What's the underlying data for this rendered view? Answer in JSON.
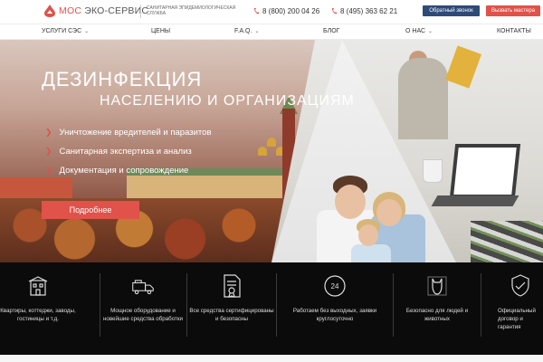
{
  "header": {
    "logo_part1": "МОС",
    "logo_part2": "ЭКО-СЕРВИС",
    "tagline": "Санитарная эпидемиологическая служба",
    "phone1": "8 (800) 200 04 26",
    "phone2": "8 (495) 363 62 21",
    "callback_label": "Обратный звонок",
    "master_label": "Вызвать мастера"
  },
  "nav": {
    "items": [
      {
        "label": "УСЛУГИ СЭС",
        "dropdown": true
      },
      {
        "label": "ЦЕНЫ",
        "dropdown": false
      },
      {
        "label": "F.A.Q.",
        "dropdown": true
      },
      {
        "label": "БЛОГ",
        "dropdown": false
      },
      {
        "label": "О НАС",
        "dropdown": true
      },
      {
        "label": "КОНТАКТЫ",
        "dropdown": false
      }
    ]
  },
  "hero": {
    "title": "ДЕЗИНФЕКЦИЯ",
    "subtitle": "НАСЕЛЕНИЮ И ОРГАНИЗАЦИЯМ",
    "bullets": [
      "Уничтожение вредителей и паразитов",
      "Санитарная экспертиза и анализ",
      "Документация и сопровождение"
    ],
    "button_label": "Подробнее"
  },
  "features": [
    {
      "icon": "building-icon",
      "text": "Квартиры, коттеджи, заводы, гостиницы и т.д."
    },
    {
      "icon": "truck-icon",
      "text": "Мощное оборудование и новейшие средства обработки"
    },
    {
      "icon": "certificate-icon",
      "text": "Все средства сертифицированы и безопасны"
    },
    {
      "icon": "clock-24-icon",
      "text": "Работаем без выходных, заявки круглосуточно"
    },
    {
      "icon": "cat-icon",
      "text": "Безопасно для людей и животных"
    },
    {
      "icon": "shield-check-icon",
      "text": "Официальный договор и гарантия"
    }
  ],
  "colors": {
    "accent": "#e0524a",
    "navy": "#2e4a78",
    "strip": "#0b0b0b"
  }
}
